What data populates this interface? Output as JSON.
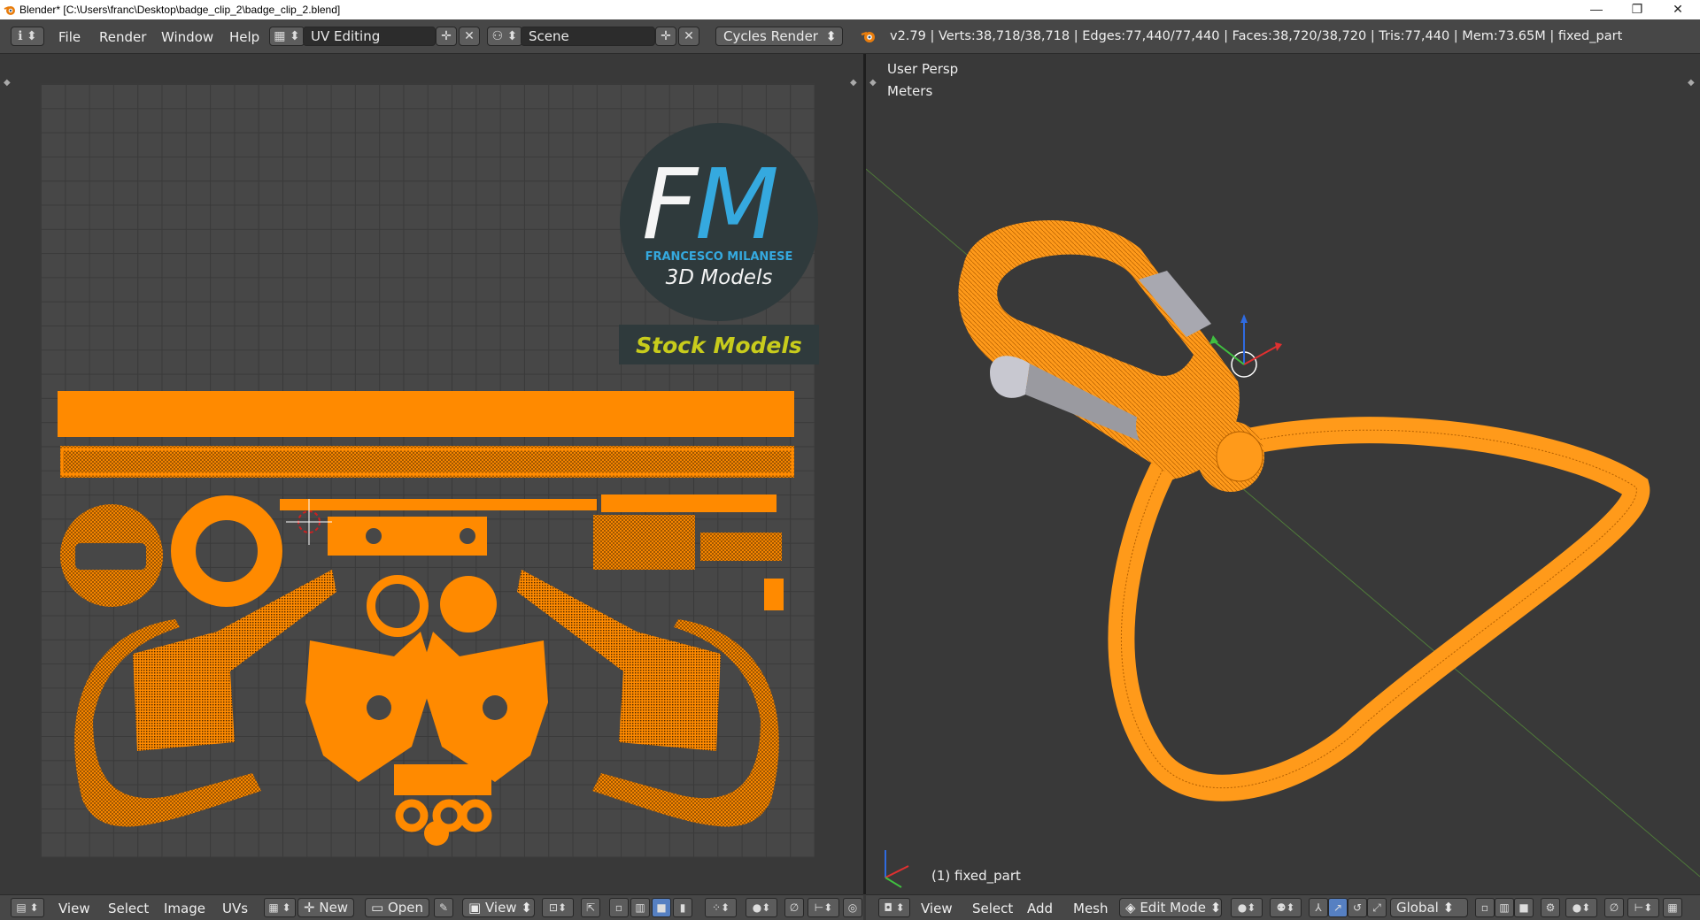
{
  "window": {
    "title": "Blender* [C:\\Users\\franc\\Desktop\\badge_clip_2\\badge_clip_2.blend]",
    "controls": [
      "—",
      "❐",
      "✕"
    ]
  },
  "info_header": {
    "editor_menu_icon": "ℹ",
    "menus": [
      "File",
      "Render",
      "Window",
      "Help"
    ],
    "screen_layout": "UV Editing",
    "scene": "Scene",
    "render_engine": "Cycles Render",
    "stats": "v2.79 | Verts:38,718/38,718 | Edges:77,440/77,440 | Faces:38,720/38,720 | Tris:77,440 | Mem:73.65M | fixed_part"
  },
  "uv_editor": {
    "watermark": {
      "logo_letters": "FM",
      "author": "FRANCESCO MILANESE",
      "subtitle": "3D Models",
      "banner": "Stock Models"
    },
    "uv_color": "#ff8a00",
    "header": {
      "menus": [
        "View",
        "Select",
        "Image",
        "UVs"
      ],
      "new_label": "New",
      "open_label": "Open",
      "view_label": "View"
    }
  },
  "viewport": {
    "view_name": "User Persp",
    "units": "Meters",
    "object_label": "(1) fixed_part",
    "mesh_color": "#ff9a1a",
    "header": {
      "menus": [
        "View",
        "Select",
        "Add",
        "Mesh"
      ],
      "mode": "Edit Mode",
      "orientation": "Global"
    }
  }
}
